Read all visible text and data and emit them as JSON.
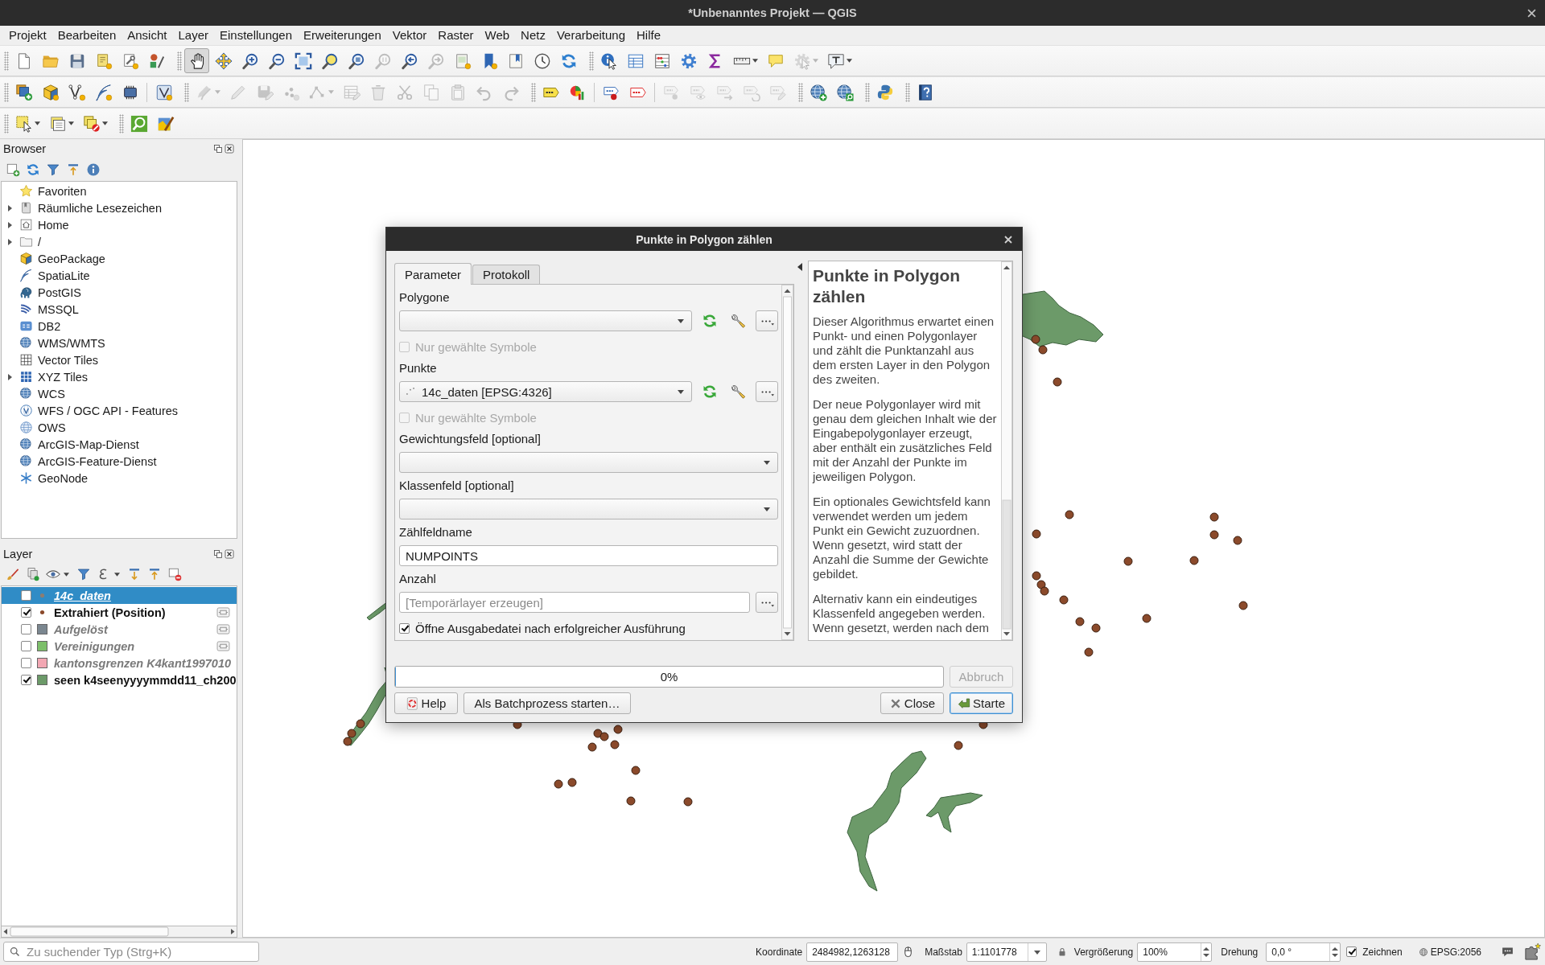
{
  "window": {
    "title": "*Unbenanntes Projekt — QGIS"
  },
  "menu": [
    "Projekt",
    "Bearbeiten",
    "Ansicht",
    "Layer",
    "Einstellungen",
    "Erweiterungen",
    "Vektor",
    "Raster",
    "Web",
    "Netz",
    "Verarbeitung",
    "Hilfe"
  ],
  "toolbars": [
    {
      "groups": [
        {
          "sections": [
            [
              {
                "disabled": false,
                "pressed": false
              },
              {
                "disabled": false,
                "pressed": false
              },
              {
                "disabled": false,
                "pressed": false
              },
              {
                "disabled": false,
                "pressed": false
              },
              {
                "disabled": false,
                "pressed": false
              },
              {
                "disabled": false,
                "pressed": false
              }
            ]
          ]
        },
        {
          "sections": [
            [
              {
                "disabled": false,
                "pressed": true
              },
              {
                "disabled": false,
                "pressed": false
              },
              {
                "disabled": false,
                "pressed": false
              },
              {
                "disabled": false,
                "pressed": false
              },
              {
                "disabled": false,
                "pressed": false
              },
              {
                "disabled": false,
                "pressed": false
              },
              {
                "disabled": false,
                "pressed": false
              },
              {
                "disabled": true,
                "pressed": false
              },
              {
                "disabled": false,
                "pressed": false
              },
              {
                "disabled": true,
                "pressed": false
              },
              {
                "disabled": false,
                "pressed": false
              },
              {
                "disabled": false,
                "pressed": false
              },
              {
                "disabled": false,
                "pressed": false
              },
              {
                "disabled": false,
                "pressed": false
              },
              {
                "disabled": false,
                "pressed": false
              }
            ]
          ]
        },
        {
          "sections": [
            [
              {
                "disabled": false,
                "pressed": false
              },
              {
                "disabled": false,
                "pressed": false
              },
              {
                "disabled": false,
                "pressed": false
              },
              {
                "disabled": false,
                "pressed": false
              },
              {
                "disabled": false,
                "pressed": false
              },
              {
                "disabled": false,
                "pressed": false
              },
              {
                "disabled": false,
                "pressed": false
              },
              {
                "disabled": true,
                "pressed": false
              },
              {
                "disabled": false,
                "pressed": false
              }
            ]
          ]
        }
      ]
    },
    {
      "groups": [
        {
          "sections": [
            [
              {
                "disabled": false,
                "pressed": false
              },
              {
                "disabled": false,
                "pressed": false
              },
              {
                "disabled": false,
                "pressed": false
              },
              {
                "disabled": false,
                "pressed": false
              },
              {
                "disabled": false,
                "pressed": false
              }
            ],
            [
              {
                "disabled": false,
                "pressed": false
              }
            ]
          ]
        },
        {
          "sections": [
            [
              {
                "disabled": true,
                "pressed": false
              },
              {
                "disabled": true,
                "pressed": false
              },
              {
                "disabled": true,
                "pressed": false
              },
              {
                "disabled": true,
                "pressed": false
              },
              {
                "disabled": true,
                "pressed": false
              },
              {
                "disabled": true,
                "pressed": false
              },
              {
                "disabled": true,
                "pressed": false
              },
              {
                "disabled": true,
                "pressed": false
              },
              {
                "disabled": true,
                "pressed": false
              },
              {
                "disabled": true,
                "pressed": false
              },
              {
                "disabled": true,
                "pressed": false
              },
              {
                "disabled": true,
                "pressed": false
              }
            ]
          ]
        },
        {
          "sections": [
            [
              {
                "disabled": false,
                "pressed": false
              },
              {
                "disabled": false,
                "pressed": false
              }
            ],
            [
              {
                "disabled": false,
                "pressed": false
              },
              {
                "disabled": false,
                "pressed": false
              }
            ],
            [
              {
                "disabled": true,
                "pressed": false
              },
              {
                "disabled": true,
                "pressed": false
              },
              {
                "disabled": true,
                "pressed": false
              },
              {
                "disabled": true,
                "pressed": false
              },
              {
                "disabled": true,
                "pressed": false
              }
            ]
          ]
        },
        {
          "sections": [
            [
              {
                "disabled": false,
                "pressed": false
              },
              {
                "disabled": false,
                "pressed": false
              }
            ]
          ]
        },
        {
          "sections": [
            [
              {
                "disabled": false,
                "pressed": false
              }
            ]
          ]
        },
        {
          "sections": [
            [
              {
                "disabled": false,
                "pressed": false
              }
            ]
          ]
        }
      ]
    },
    {
      "groups": [
        {
          "sections": [
            [
              {
                "disabled": false,
                "pressed": false
              },
              {
                "disabled": false,
                "pressed": false
              },
              {
                "disabled": false,
                "pressed": false
              }
            ]
          ]
        },
        {
          "sections": [
            [
              {
                "disabled": false,
                "pressed": false
              },
              {
                "disabled": false,
                "pressed": false
              }
            ]
          ]
        }
      ]
    }
  ],
  "browser": {
    "title": "Browser",
    "items": [
      {
        "label": "Favoriten",
        "expandable": false
      },
      {
        "label": "Räumliche Lesezeichen",
        "expandable": true
      },
      {
        "label": "Home",
        "expandable": true
      },
      {
        "label": "/",
        "expandable": true
      },
      {
        "label": "GeoPackage",
        "expandable": false
      },
      {
        "label": "SpatiaLite",
        "expandable": false
      },
      {
        "label": "PostGIS",
        "expandable": false
      },
      {
        "label": "MSSQL",
        "expandable": false
      },
      {
        "label": "DB2",
        "expandable": false
      },
      {
        "label": "WMS/WMTS",
        "expandable": false
      },
      {
        "label": "Vector Tiles",
        "expandable": false
      },
      {
        "label": "XYZ Tiles",
        "expandable": true
      },
      {
        "label": "WCS",
        "expandable": false
      },
      {
        "label": "WFS / OGC API - Features",
        "expandable": false
      },
      {
        "label": "OWS",
        "expandable": false
      },
      {
        "label": "ArcGIS-Map-Dienst",
        "expandable": false
      },
      {
        "label": "ArcGIS-Feature-Dienst",
        "expandable": false
      },
      {
        "label": "GeoNode",
        "expandable": false
      }
    ]
  },
  "layers_panel": {
    "title": "Layer",
    "layers": [
      {
        "name": "14c_daten",
        "kind": "point",
        "color": "#8d7d72",
        "checked": false,
        "selected": true,
        "temporary": false
      },
      {
        "name": "Extrahiert (Position)",
        "kind": "point",
        "color": "#8b4a2b",
        "checked": true,
        "selected": false,
        "temporary": true
      },
      {
        "name": "Aufgelöst",
        "kind": "polygon",
        "color": "#7b8790",
        "checked": false,
        "selected": false,
        "temporary": true
      },
      {
        "name": "Vereinigungen",
        "kind": "polygon",
        "color": "#7dbf6a",
        "checked": false,
        "selected": false,
        "temporary": true
      },
      {
        "name": "kantonsgrenzen K4kant1997010",
        "kind": "polygon",
        "color": "#f2a7b3",
        "checked": false,
        "selected": false,
        "temporary": false
      },
      {
        "name": "seen k4seenyyyymmdd11_ch200",
        "kind": "polygon",
        "color": "#6c9a69",
        "checked": true,
        "selected": false,
        "temporary": false
      }
    ]
  },
  "dialog": {
    "title": "Punkte in Polygon zählen",
    "tabs": [
      {
        "label": "Parameter",
        "selected": true
      },
      {
        "label": "Protokoll",
        "selected": false
      }
    ],
    "parameters": [
      {
        "kind": "layer",
        "label": "Polygone"
      },
      {
        "kind": "checkbox",
        "label": "Nur gewählte Symbole",
        "checked": false,
        "disabled": true
      },
      {
        "kind": "layer",
        "label": "Punkte",
        "value": "14c_daten [EPSG:4326]"
      },
      {
        "kind": "checkbox",
        "label": "Nur gewählte Symbole",
        "checked": false,
        "disabled": true
      },
      {
        "kind": "field",
        "label": "Gewichtungsfeld [optional]"
      },
      {
        "kind": "field",
        "label": "Klassenfeld [optional]"
      },
      {
        "kind": "text",
        "label": "Zählfeldname",
        "value": "NUMPOINTS"
      },
      {
        "kind": "output",
        "label": "Anzahl",
        "placeholder": "[Temporärlayer erzeugen]"
      },
      {
        "kind": "checkbox",
        "label": "Öffne Ausgabedatei nach erfolgreicher Ausführung",
        "checked": true,
        "disabled": false
      }
    ],
    "help": {
      "heading": "Punkte in Polygon zählen",
      "paragraphs": [
        "Dieser Algorithmus erwartet einen Punkt- und einen Polygonlayer und zählt die Punktanzahl aus dem ersten Layer in den Polygon des zweiten.",
        "Der neue Polygonlayer wird mit genau dem gleichen Inhalt wie der Eingabepolygonlayer erzeugt, aber enthält ein zusätzliches Feld mit der Anzahl der Punkte im jeweiligen Polygon.",
        "Ein optionales Gewichtsfeld kann verwendet werden um jedem Punkt ein Gewicht zuzuordnen. Wenn gesetzt, wird statt der Anzahl die Summe der Gewichte gebildet.",
        "Alternativ kann ein eindeutiges Klassenfeld angegeben werden. Wenn gesetzt, werden nach dem"
      ]
    },
    "progress": {
      "level": 0,
      "text": "0%"
    },
    "buttons": [
      {
        "kind": "cancel",
        "label": "Abbruch",
        "disabled": true,
        "default": false
      },
      {
        "kind": "help",
        "label": "Help",
        "disabled": false,
        "default": false
      },
      {
        "kind": "batch",
        "label": "Als Batchprozess starten…",
        "disabled": false,
        "default": false
      },
      {
        "kind": "close",
        "label": "Close",
        "disabled": false,
        "default": false
      },
      {
        "kind": "run",
        "label": "Starte",
        "disabled": false,
        "default": true
      }
    ]
  },
  "status_bar": {
    "search": {
      "placeholder": "Zu suchender Typ (Strg+K)"
    },
    "coordinate": {
      "label": "Koordinate",
      "value": "2484982,1263128"
    },
    "scale": {
      "label": "Maßstab",
      "value": "1:1101778"
    },
    "magnifier": {
      "label": "Vergrößerung",
      "value": "100%"
    },
    "rotation": {
      "label": "Drehung",
      "value": "0,0 °"
    },
    "render": {
      "label": "Zeichnen",
      "checked": true
    },
    "crs": "EPSG:2056"
  }
}
